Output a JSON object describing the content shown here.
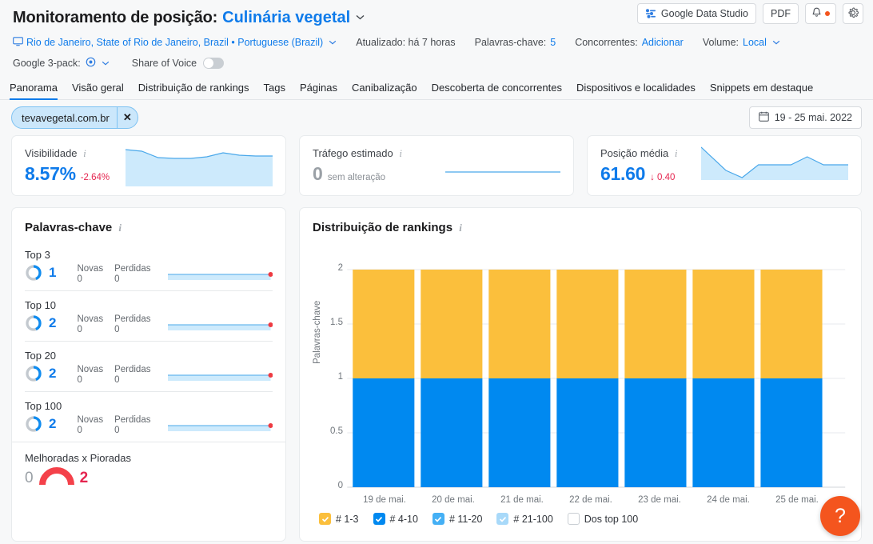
{
  "header": {
    "title_prefix": "Monitoramento de posição:",
    "project_name": "Culinária vegetal",
    "caret": "⌄",
    "location": "Rio de Janeiro, State of Rio de Janeiro, Brazil • Portuguese (Brazil)",
    "updated_label": "Atualizado: há 7 horas",
    "keywords_label": "Palavras-chave:",
    "keywords_value": "5",
    "competitors_label": "Concorrentes:",
    "competitors_link": "Adicionar",
    "volume_label": "Volume:",
    "volume_value": "Local",
    "google3pack_label": "Google 3-pack:",
    "sov_label": "Share of Voice",
    "actions": {
      "data_studio": "Google Data Studio",
      "pdf": "PDF",
      "bell_icon": "bell-icon",
      "gear_icon": "gear-icon"
    }
  },
  "tabs": [
    {
      "label": "Panorama",
      "active": true
    },
    {
      "label": "Visão geral",
      "active": false
    },
    {
      "label": "Distribuição de rankings",
      "active": false
    },
    {
      "label": "Tags",
      "active": false
    },
    {
      "label": "Páginas",
      "active": false
    },
    {
      "label": "Canibalização",
      "active": false
    },
    {
      "label": "Descoberta de concorrentes",
      "active": false
    },
    {
      "label": "Dispositivos e localidades",
      "active": false
    },
    {
      "label": "Snippets em destaque",
      "active": false
    }
  ],
  "filters": {
    "domain_chip": "tevavegetal.com.br",
    "domain_chip_close": "✕",
    "date_range": "19 - 25 mai. 2022",
    "calendar_icon": "calendar-icon"
  },
  "kpis": [
    {
      "label": "Visibilidade",
      "value": "8.57%",
      "delta": "-2.64%",
      "delta_kind": "negative",
      "spark": "0,14 62,8 124,22 186,24 248,23 310,19 372,12 434,16 496,18 558,18"
    },
    {
      "label": "Tráfego estimado",
      "value": "0",
      "delta": "sem alteração",
      "delta_kind": "neutral",
      "spark": "flat"
    },
    {
      "label": "Posição média",
      "value": "61.60",
      "delta": "↓ 0.40",
      "delta_kind": "negative",
      "spark": "0,4 62,26 124,46 186,28 248,20 310,20 372,14 434,10 496,18 558,18"
    }
  ],
  "keywords_panel": {
    "title": "Palavras-chave",
    "rows": [
      {
        "label": "Top 3",
        "count": "1",
        "new_label": "Novas",
        "new_value": "0",
        "lost_label": "Perdidas",
        "lost_value": "0",
        "fill_pct": 100,
        "ring_pct": 42
      },
      {
        "label": "Top 10",
        "count": "2",
        "new_label": "Novas",
        "new_value": "0",
        "lost_label": "Perdidas",
        "lost_value": "0",
        "fill_pct": 100,
        "ring_pct": 42
      },
      {
        "label": "Top 20",
        "count": "2",
        "new_label": "Novas",
        "new_value": "0",
        "lost_label": "Perdidas",
        "lost_value": "0",
        "fill_pct": 100,
        "ring_pct": 42
      },
      {
        "label": "Top 100",
        "count": "2",
        "new_label": "Novas",
        "new_value": "0",
        "lost_label": "Perdidas",
        "lost_value": "0",
        "fill_pct": 100,
        "ring_pct": 42
      }
    ],
    "improved_vs_declined": {
      "label": "Melhoradas x Pioradas",
      "improved": "0",
      "declined": "2"
    }
  },
  "chart_panel": {
    "title": "Distribuição de rankings"
  },
  "chart_data": {
    "type": "bar",
    "stacked": true,
    "title": "Distribuição de rankings",
    "xlabel": "",
    "ylabel": "Palavras-chave",
    "categories": [
      "19 de mai.",
      "20 de mai.",
      "21 de mai.",
      "22 de mai.",
      "23 de mai.",
      "24 de mai.",
      "25 de mai."
    ],
    "yticks": [
      "0",
      "0.5",
      "1",
      "1.5",
      "2"
    ],
    "ylim": [
      0,
      2
    ],
    "grid": true,
    "legend_position": "bottom",
    "series": [
      {
        "name": "# 4-10",
        "color": "#0089f0",
        "values": [
          1,
          1,
          1,
          1,
          1,
          1,
          1
        ]
      },
      {
        "name": "# 1-3",
        "color": "#fbbf3c",
        "values": [
          1,
          1,
          1,
          1,
          1,
          1,
          1
        ]
      }
    ],
    "legend": [
      {
        "label": "# 1-3",
        "color": "#fbbf3c",
        "checked": true
      },
      {
        "label": "# 4-10",
        "color": "#0089f0",
        "checked": true
      },
      {
        "label": "# 11-20",
        "color": "#45b0f5",
        "checked": true
      },
      {
        "label": "# 21-100",
        "color": "#a8d9f9",
        "checked": true
      },
      {
        "label": "Dos top 100",
        "color": "#ffffff",
        "checked": false
      }
    ]
  },
  "help": {
    "label": "?"
  }
}
